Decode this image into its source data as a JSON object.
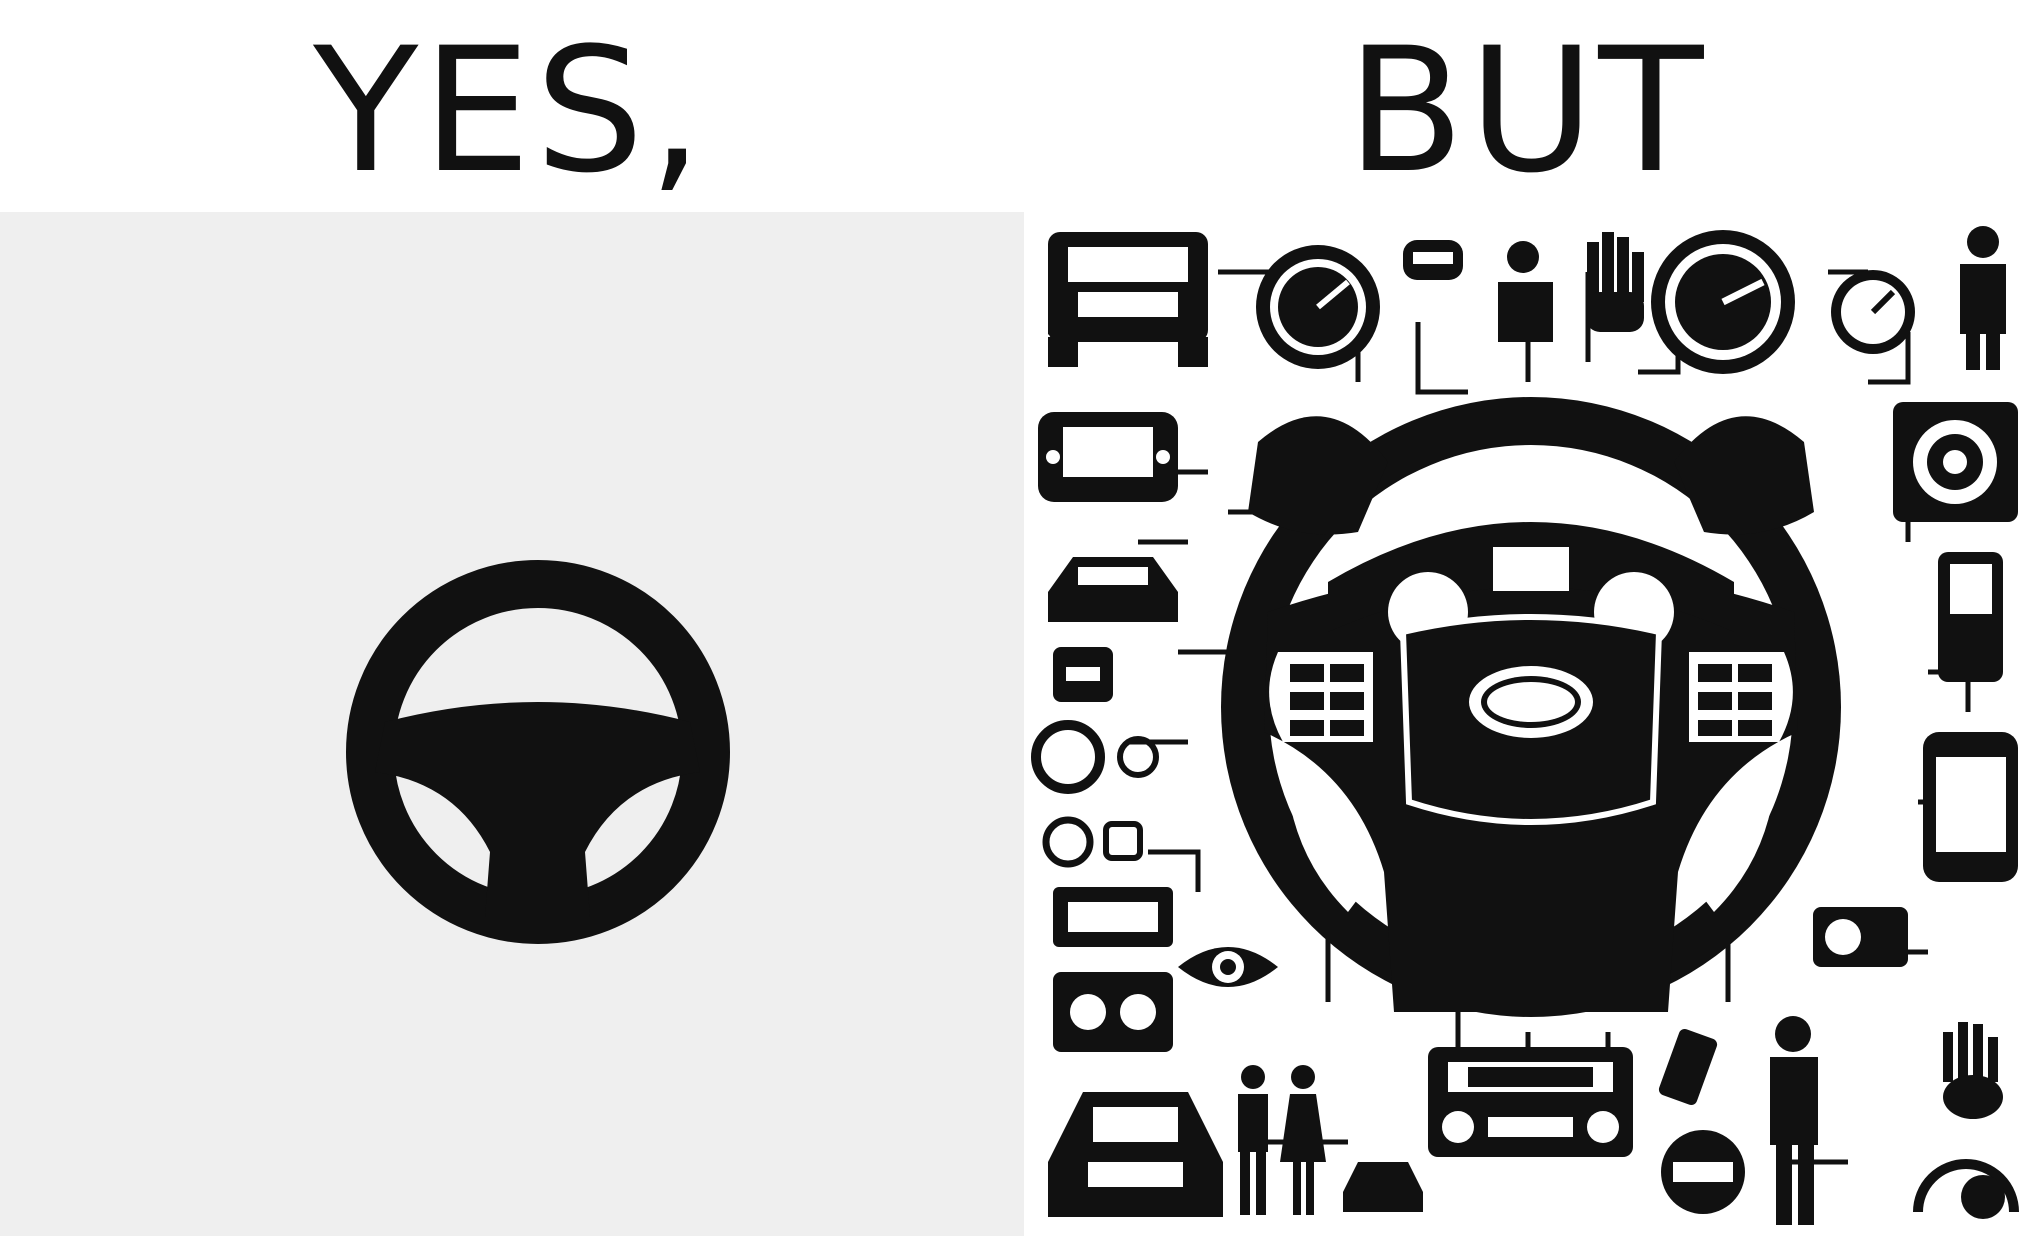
{
  "left": {
    "heading": "YES,",
    "icon": "simple-steering-wheel-icon",
    "background": "#efefef"
  },
  "right": {
    "heading": "BUT",
    "icon": "complex-steering-wheel-with-controls-icon",
    "background": "#ffffff"
  },
  "colors": {
    "ink": "#111111",
    "paper": "#ffffff"
  }
}
